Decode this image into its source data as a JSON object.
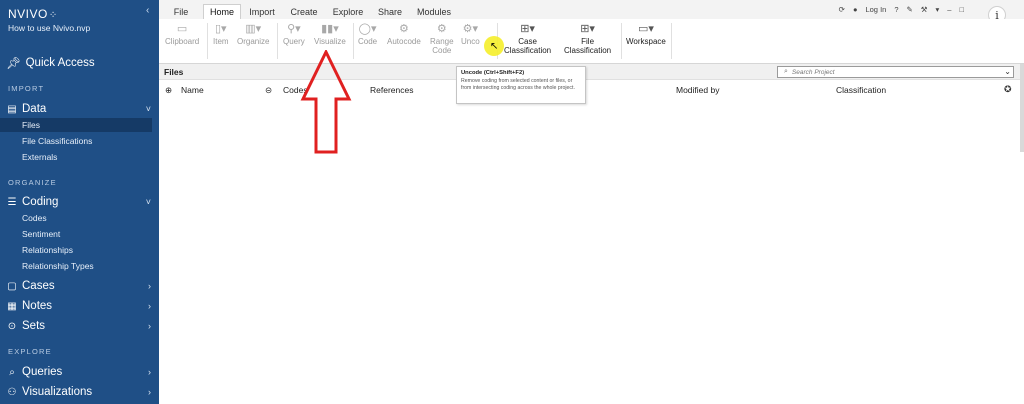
{
  "app": {
    "brand": "NVIVO",
    "brand_dots": "⁘",
    "collapse_icon": "chevron-left-icon",
    "project_name": "How to use Nvivo.nvp"
  },
  "sidebar": {
    "quick_access": "Quick Access",
    "sections": [
      {
        "label": "IMPORT",
        "groups": [
          {
            "label": "Data",
            "icon": "data-icon",
            "chevron": "˅",
            "items": [
              "Files",
              "File Classifications",
              "Externals"
            ],
            "active_item": "Files"
          }
        ]
      },
      {
        "label": "ORGANIZE",
        "groups": [
          {
            "label": "Coding",
            "icon": "coding-icon",
            "chevron": "˅",
            "items": [
              "Codes",
              "Sentiment",
              "Relationships",
              "Relationship Types"
            ]
          },
          {
            "label": "Cases",
            "icon": "cases-icon",
            "chevron": "›"
          },
          {
            "label": "Notes",
            "icon": "notes-icon",
            "chevron": "›"
          },
          {
            "label": "Sets",
            "icon": "sets-icon",
            "chevron": "›"
          }
        ]
      },
      {
        "label": "EXPLORE",
        "groups": [
          {
            "label": "Queries",
            "icon": "queries-icon",
            "chevron": "›"
          },
          {
            "label": "Visualizations",
            "icon": "visualizations-icon",
            "chevron": "›"
          }
        ]
      }
    ]
  },
  "tabs": [
    "File",
    "Home",
    "Import",
    "Create",
    "Explore",
    "Share",
    "Modules"
  ],
  "active_tab": "Home",
  "window_controls": {
    "login": "Log In",
    "icons": [
      "refresh-icon",
      "user-icon",
      "help-icon",
      "pin-icon",
      "tools-icon",
      "dropdown-icon",
      "minimize-icon",
      "restore-icon",
      "close-icon"
    ]
  },
  "ribbon": {
    "buttons": [
      {
        "label": "Clipboard",
        "icon": "clipboard-icon",
        "enabled": false
      },
      {
        "label": "Item",
        "icon": "item-icon",
        "enabled": false
      },
      {
        "label": "Organize",
        "icon": "organize-icon",
        "enabled": false
      },
      {
        "label": "Query",
        "icon": "query-icon",
        "enabled": false
      },
      {
        "label": "Visualize",
        "icon": "visualize-icon",
        "enabled": false
      },
      {
        "label": "Code",
        "icon": "code-icon",
        "enabled": false
      },
      {
        "label": "Autocode",
        "icon": "autocode-icon",
        "enabled": false
      },
      {
        "label": "Range\nCode",
        "icon": "range-code-icon",
        "enabled": false
      },
      {
        "label": "Unco",
        "icon": "uncode-icon",
        "enabled": false
      },
      {
        "label": "Case\nClassification",
        "icon": "case-classification-icon",
        "enabled": true
      },
      {
        "label": "File\nClassification",
        "icon": "file-classification-icon",
        "enabled": true
      },
      {
        "label": "Workspace",
        "icon": "workspace-icon",
        "enabled": true
      }
    ]
  },
  "files_pane": {
    "title": "Files",
    "search_placeholder": "Search Project",
    "columns": [
      "Name",
      "Codes",
      "References",
      "Modified by",
      "Classification"
    ]
  },
  "tooltip": {
    "title": "Uncode (Ctrl+Shift+F2)",
    "body": "Remove coding from selected content or files, or from intersecting coding across the whole project."
  },
  "colors": {
    "sidebar_bg": "#1f4f86",
    "sidebar_active": "#153a66",
    "annotation_arrow": "#e02020",
    "cursor_highlight": "#f5ee2a"
  }
}
